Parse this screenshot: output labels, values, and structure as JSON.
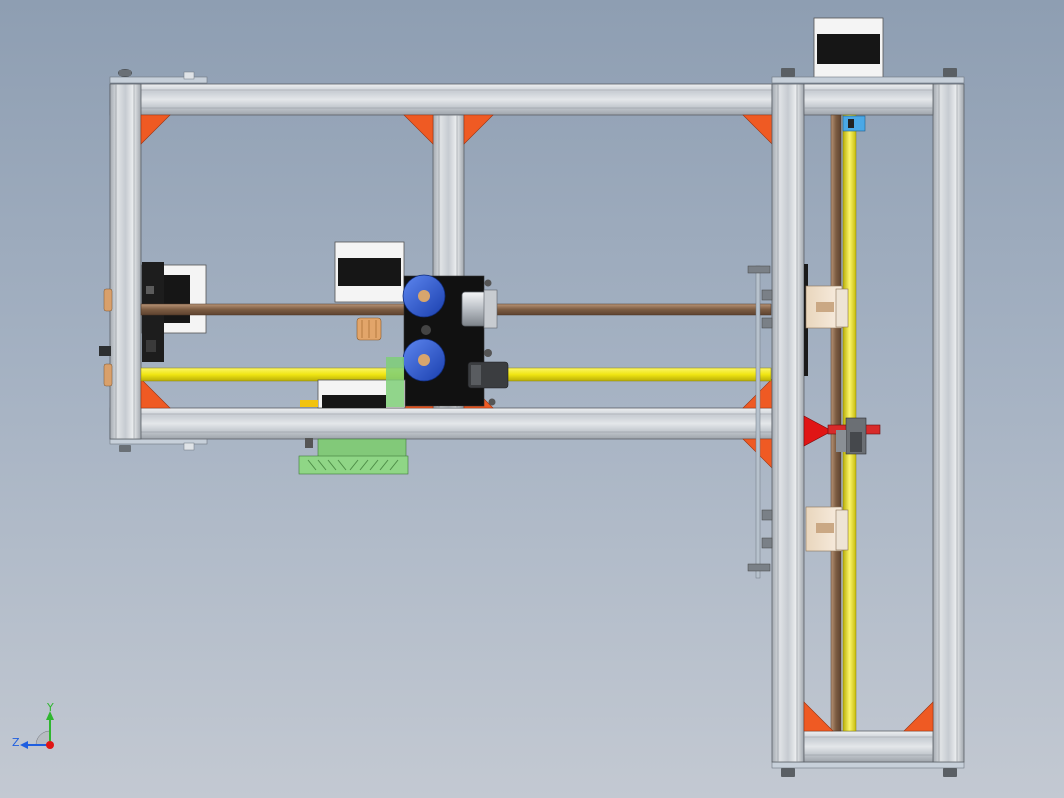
{
  "view": {
    "kind": "cad-assembly-front-view",
    "background_top": "#8e9eb2",
    "background_bottom": "#c3c9d2"
  },
  "colors": {
    "aluminium_profile": "#d2d6da",
    "profile_edge": "#5a5f66",
    "corner_bracket": "#ef5a23",
    "rod_bronze": "#8a6a4e",
    "rod_yellow": "#f2ea1c",
    "motor_black": "#161616",
    "motor_white": "#f4f4f4",
    "pulley_blue": "#1f4fcf",
    "pulley_brass": "#e2a56a",
    "bearing_block_cream": "#f0e1cc",
    "board_green": "#7fcf78",
    "pointer_red": "#e01515",
    "endstop_blue": "#4aa8e6"
  },
  "triad": {
    "y_label": "Y",
    "z_label": "Z",
    "y_color": "#2fb62f",
    "z_color": "#1f5fe0",
    "x_color": "#e01515"
  }
}
